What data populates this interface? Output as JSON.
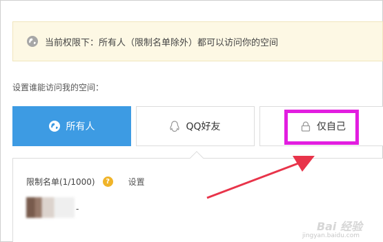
{
  "notice": {
    "icon": "globe-icon",
    "text": "当前权限下：所有人（限制名单除外）都可以访问你的空间"
  },
  "section": {
    "label": "设置谁能访问我的空间："
  },
  "options": [
    {
      "icon": "globe-icon",
      "label": "所有人",
      "selected": true
    },
    {
      "icon": "qq-penguin-icon",
      "label": "QQ好友",
      "selected": false
    },
    {
      "icon": "lock-icon",
      "label": "仅自己",
      "selected": false
    }
  ],
  "limit": {
    "label": "限制名单(1/1000)",
    "help": "?",
    "setting": "设置"
  },
  "avatar_suffix": "-",
  "watermark": {
    "main": "Bai 经验",
    "sub": "jingyan.baidu.com"
  },
  "colors": {
    "accent": "#3d9be3",
    "highlight": "#e21ee0",
    "arrow": "#e8344a",
    "notice_bg": "#fdf8e4"
  }
}
